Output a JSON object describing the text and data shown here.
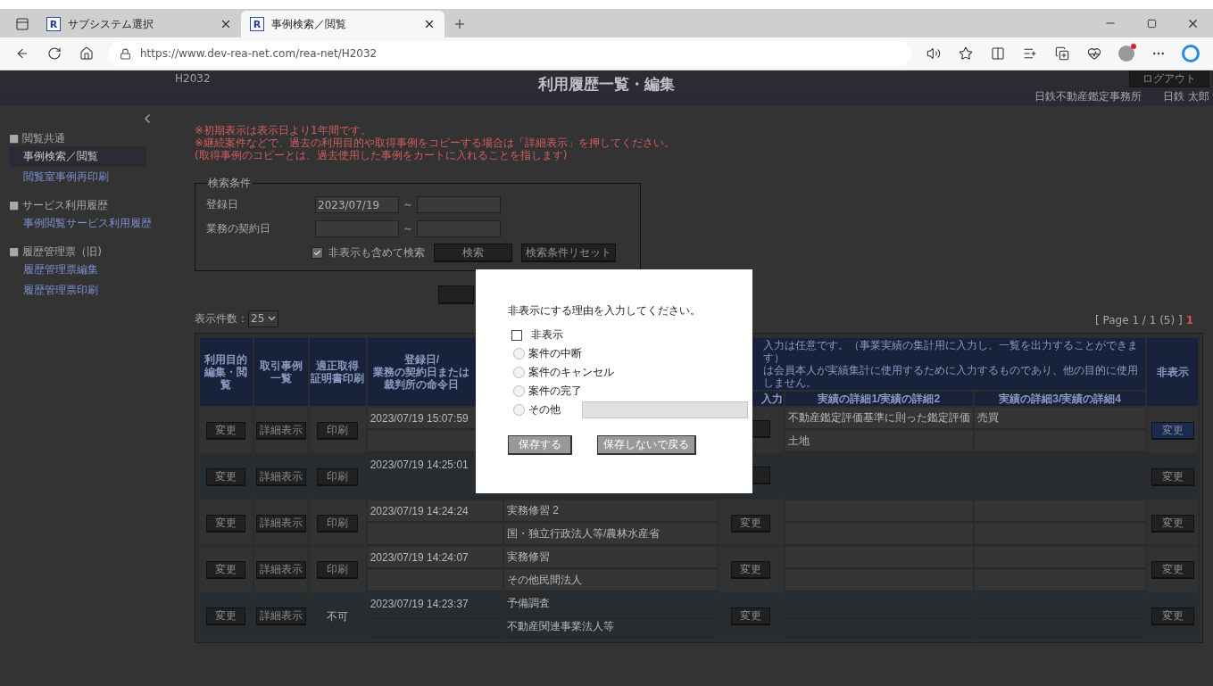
{
  "browser": {
    "tabs": [
      {
        "icon_text": "R",
        "title": "サブシステム選択",
        "selected": false
      },
      {
        "icon_text": "R",
        "title": "事例検索／閲覧",
        "selected": true
      }
    ],
    "url": "https://www.dev-rea-net.com/rea-net/H2032"
  },
  "header": {
    "screen_id": "H2032",
    "title": "利用履歴一覧・編集",
    "logout": "ログアウト",
    "office": "日鉄不動産鑑定事務所",
    "user": "日鉄 太郎"
  },
  "sidebar": {
    "sections": [
      {
        "heading": "■ 閲覧共通",
        "items": [
          {
            "label": "事例検索／閲覧",
            "selected": true
          },
          {
            "label": "閲覧室事例再印刷",
            "selected": false
          }
        ]
      },
      {
        "heading": "■ サービス利用履歴",
        "items": [
          {
            "label": "事例閲覧サービス利用履歴",
            "selected": false
          }
        ]
      },
      {
        "heading": "■ 履歴管理票（旧)",
        "items": [
          {
            "label": "履歴管理票編集",
            "selected": false
          },
          {
            "label": "履歴管理票印刷",
            "selected": false
          }
        ]
      }
    ]
  },
  "notes": [
    "※初期表示は表示日より1年間です。",
    "※継続案件などで、過去の利用目的や取得事例をコピーする場合は「詳細表示」を押してください。",
    "(取得事例のコピーとは、過去使用した事例をカートに入れることを指します)"
  ],
  "search": {
    "legend": "検索条件",
    "fields": [
      {
        "label": "登録日",
        "from": "2023/07/19",
        "separator": "～"
      },
      {
        "label": "業務の契約日",
        "separator": "～"
      }
    ],
    "include_hidden": {
      "label": "非表示も含めて検索",
      "checked": true
    },
    "buttons": [
      "検索",
      "検索条件リセット"
    ]
  },
  "per_page": {
    "label": "表示件数：",
    "value": "25"
  },
  "pagination": {
    "summary": "[ Page 1 / 1 (5) ]",
    "pages": [
      {
        "label": "1",
        "selected": true
      }
    ]
  },
  "table": {
    "columns": [
      {
        "lines": [
          "利用目的",
          "編集・閲覧"
        ]
      },
      {
        "lines": [
          "取引事例",
          "一覧"
        ]
      },
      {
        "lines": [
          "適正取得",
          "証明書印刷"
        ]
      },
      {
        "lines": [
          "登録日/",
          "業務の契約日または",
          "裁判所の命令日"
        ]
      },
      {
        "lines": [
          "非表示"
        ]
      }
    ],
    "note": [
      "入力は任意です。（事業実績の集計用に入力し、一覧を出力することができます）",
      "は会員本人が実績集計に使用するために入力するものであり、他の目的に使用しません。"
    ],
    "sub_columns": [
      "入力",
      "実績の詳細1/実績の詳細2",
      "実績の詳細3/実績の詳細4"
    ],
    "rows": [
      {
        "hidden": false,
        "edit": "変更",
        "detail": "詳細表示",
        "print": {
          "kind": "button",
          "label": "印刷"
        },
        "date": "2023/07/19 15:07:59",
        "detail1": [
          "不動産鑑定評価基準に則った鑑定評価",
          "土地"
        ],
        "detail2": [
          "売買"
        ],
        "hide_button": "変更",
        "hide_focused": true
      },
      {
        "hidden": true,
        "edit": "変更",
        "detail": "詳細表示",
        "print": {
          "kind": "button",
          "label": "印刷"
        },
        "date": "2023/07/19 14:25:01",
        "hide_button": "変更",
        "hide_focused": false
      },
      {
        "hidden": false,
        "edit": "変更",
        "detail": "詳細表示",
        "print": {
          "kind": "button",
          "label": "印刷"
        },
        "date": "2023/07/19 14:24:24",
        "purpose": [
          "実務修習 2",
          "国・独立行政法人等/農林水産省"
        ],
        "input": "変更",
        "hide_button": "変更",
        "hide_focused": false
      },
      {
        "hidden": false,
        "edit": "変更",
        "detail": "詳細表示",
        "print": {
          "kind": "button",
          "label": "印刷"
        },
        "date": "2023/07/19 14:24:07",
        "purpose": [
          "実務修習",
          "その他民間法人"
        ],
        "input": "変更",
        "hide_button": "変更",
        "hide_focused": false
      },
      {
        "hidden": true,
        "edit": "変更",
        "detail": "詳細表示",
        "print": {
          "kind": "text",
          "label": "不可"
        },
        "date": "2023/07/19 14:23:37",
        "purpose": [
          "予備調査",
          "不動産関連事業法人等"
        ],
        "input": "変更",
        "hide_button": "変更",
        "hide_focused": false
      }
    ]
  },
  "dialog": {
    "prompt": "非表示にする理由を入力してください。",
    "hide": {
      "label": "非表示",
      "checked": false
    },
    "reasons": [
      {
        "label": "案件の中断",
        "selected": false
      },
      {
        "label": "案件のキャンセル",
        "selected": false
      },
      {
        "label": "案件の完了",
        "selected": false
      },
      {
        "label": "その他",
        "selected": false,
        "has_field": true
      }
    ],
    "buttons": [
      "保存する",
      "保存しないで戻る"
    ]
  }
}
